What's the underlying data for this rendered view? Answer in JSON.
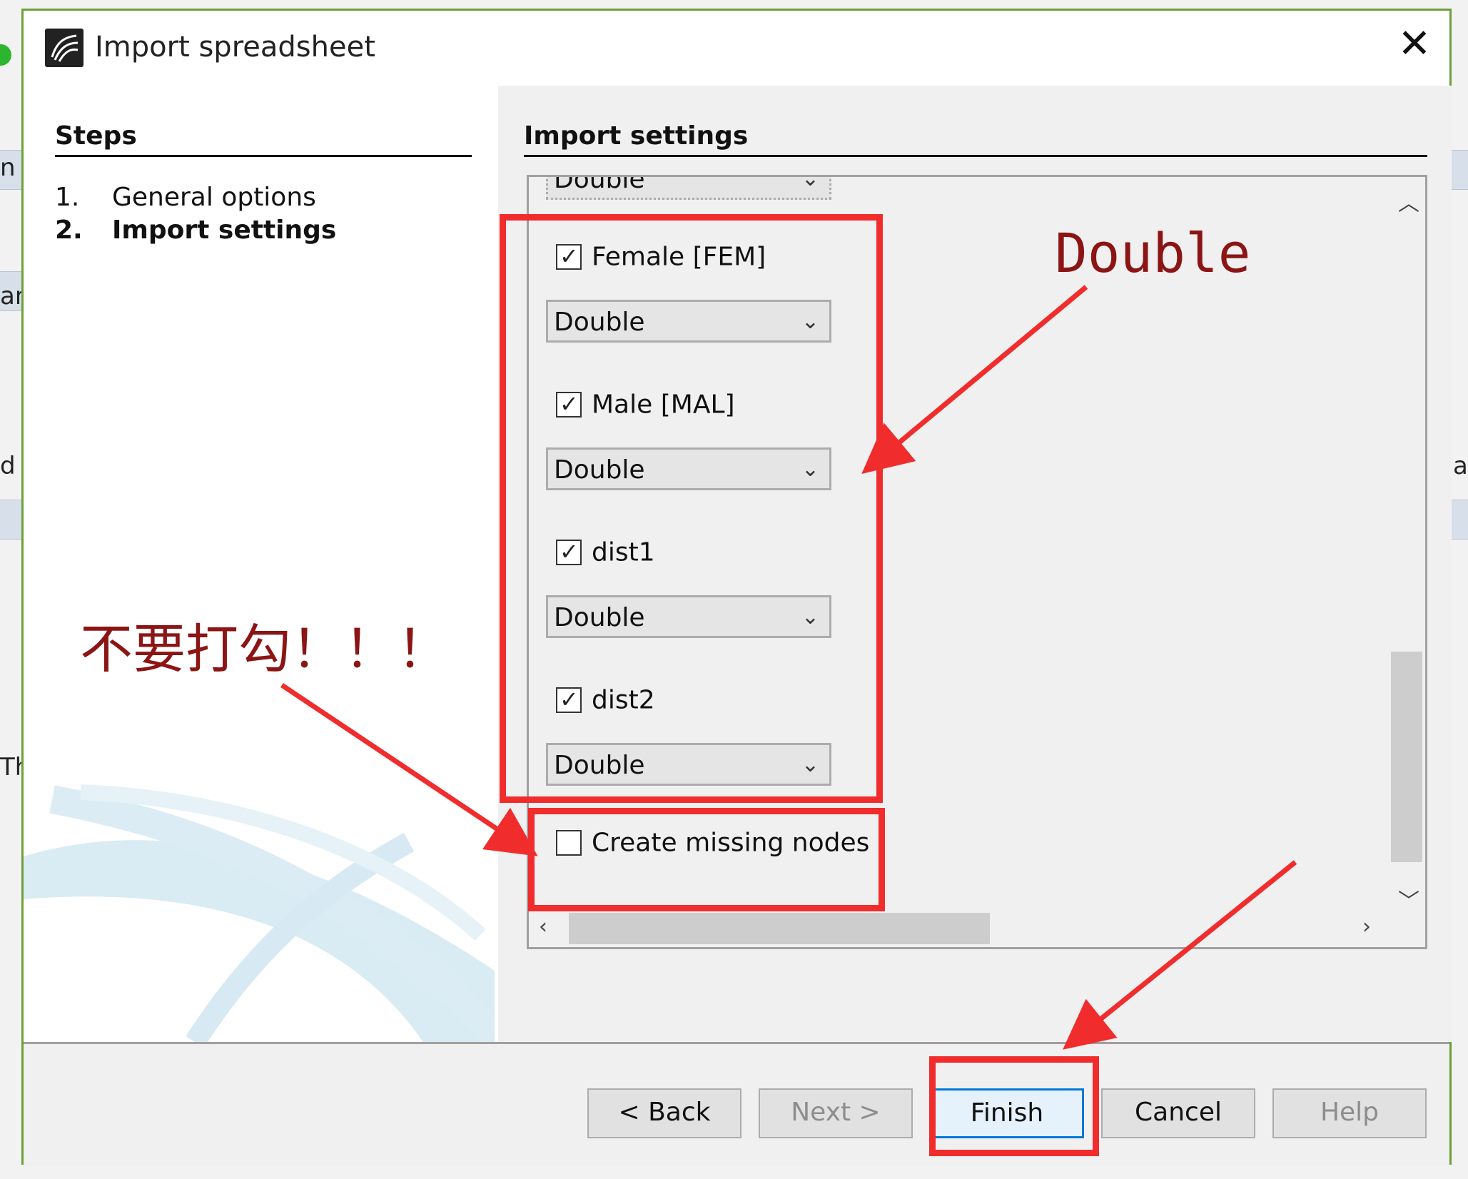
{
  "window": {
    "title": "Import spreadsheet",
    "close_glyph": "✕"
  },
  "steps": {
    "heading": "Steps",
    "items": [
      {
        "num": "1.",
        "label": "General options",
        "active": false
      },
      {
        "num": "2.",
        "label": "Import settings",
        "active": true
      }
    ]
  },
  "settings": {
    "heading": "Import settings",
    "partial_combo_value": "Double",
    "columns": [
      {
        "label": "Female [FEM]",
        "checked": true,
        "type": "Double"
      },
      {
        "label": "Male [MAL]",
        "checked": true,
        "type": "Double"
      },
      {
        "label": "dist1",
        "checked": true,
        "type": "Double"
      },
      {
        "label": "dist2",
        "checked": true,
        "type": "Double"
      }
    ],
    "create_missing_nodes": {
      "label": "Create missing nodes",
      "checked": false
    }
  },
  "buttons": {
    "back": "< Back",
    "next": "Next >",
    "finish": "Finish",
    "cancel": "Cancel",
    "help": "Help"
  },
  "annotations": {
    "double_note": "Double",
    "no_check_note": "不要打勾！！！"
  },
  "background_app": {
    "fragments": [
      "n",
      "an",
      "d E",
      "Th",
      "a"
    ]
  },
  "colors": {
    "annotation_red": "#f12c2c",
    "annotation_text": "#8b1515",
    "dialog_border": "#6ea03a",
    "default_button_border": "#0078d7"
  },
  "icons": {
    "close": "close-icon",
    "dropdown": "chevron-down-icon",
    "scroll_up": "chevron-up-icon",
    "scroll_down": "chevron-down-icon",
    "scroll_left": "chevron-left-icon",
    "scroll_right": "chevron-right-icon"
  }
}
